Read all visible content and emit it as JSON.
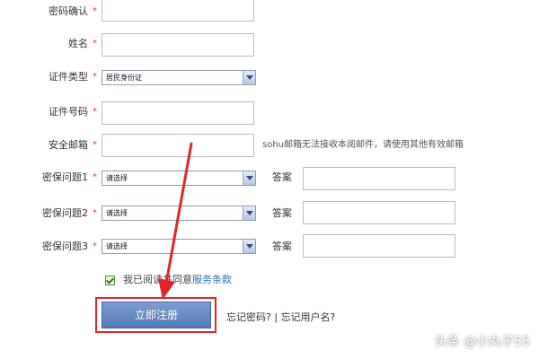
{
  "form": {
    "fields": [
      {
        "label": "密码确认",
        "required_mark": "*"
      },
      {
        "label": "姓名",
        "required_mark": "*"
      },
      {
        "label": "证件类型",
        "required_mark": "*",
        "select_value": "居民身份证"
      },
      {
        "label": "证件号码",
        "required_mark": "*"
      },
      {
        "label": "安全邮箱",
        "required_mark": "*",
        "hint": "sohu邮箱无法接收本阅邮件，请使用其他有效邮箱"
      },
      {
        "label": "密保问题1",
        "required_mark": "*",
        "select_value": "请选择",
        "answer_label": "答案"
      },
      {
        "label": "密保问题2",
        "required_mark": "*",
        "select_value": "请选择",
        "answer_label": "答案"
      },
      {
        "label": "密保问题3",
        "required_mark": "*",
        "select_value": "请选择",
        "answer_label": "答案"
      }
    ],
    "agree_text": "我已阅读并同意",
    "terms_link": "服务条款",
    "submit_label": "立即注册",
    "forgot_password": "忘记密码?",
    "separator": "|",
    "forgot_username": "忘记用户名?"
  },
  "watermark": "头条 @小丸子55",
  "colors": {
    "required": "#d33333",
    "highlight": "#e0262a",
    "button": "#5f84be",
    "link": "#2a6fb5"
  }
}
